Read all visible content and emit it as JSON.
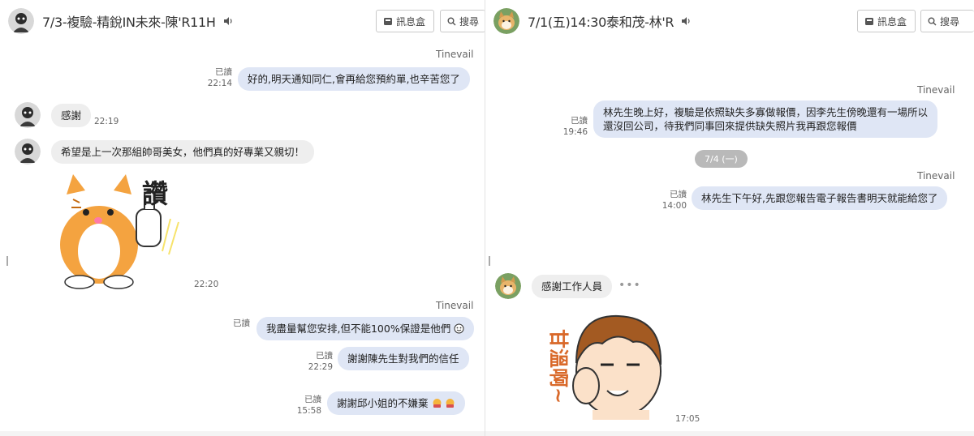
{
  "left": {
    "title": "7/3-複驗-精銳IN未來-陳'R11H",
    "inbox_label": "訊息盒",
    "search_label": "搜尋",
    "messages": [
      {
        "sender": "Tinevail",
        "text": "好的,明天通知同仁,會再給您預約單,也辛苦您了",
        "read": "已讀",
        "time": "22:14"
      },
      {
        "text": "感謝",
        "time": "22:19"
      },
      {
        "text": "希望是上一次那組帥哥美女，他們真的好專業又親切！"
      },
      {
        "sticker_text": "讚",
        "time": "22:20"
      },
      {
        "sender": "Tinevail",
        "text": "我盡量幫您安排,但不能100%保證是他們",
        "read": "已讀"
      },
      {
        "text": "謝謝陳先生對我們的信任",
        "read": "已讀",
        "time": "22:29"
      },
      {
        "text": "謝謝邱小姐的不嫌棄",
        "read": "已讀",
        "time": "15:58"
      }
    ]
  },
  "right": {
    "title": "7/1(五)14:30泰和茂-林'R",
    "inbox_label": "訊息盒",
    "search_label": "搜尋",
    "messages": [
      {
        "sender": "Tinevail",
        "line1": "林先生晚上好，複驗是依照缺失多寡做報價，因李先生傍晚還有一場所以",
        "line2": "還沒回公司，待我們同事回來提供缺失照片我再跟您報價",
        "read": "已讀",
        "time": "19:46"
      },
      {
        "date": "7/4 (一)"
      },
      {
        "sender": "Tinevail",
        "text": "林先生下午好,先跟您報告電子報告書明天就能給您了",
        "read": "已讀",
        "time": "14:00"
      },
      {
        "text": "感謝工作人員",
        "dots": "•••"
      },
      {
        "sticker_text": "甘溫啊~",
        "time": "17:05"
      }
    ]
  },
  "colors": {
    "bubble_out": "#dfe6f5",
    "bubble_in": "#eeeeee",
    "date_pill": "#b9b9b9"
  }
}
